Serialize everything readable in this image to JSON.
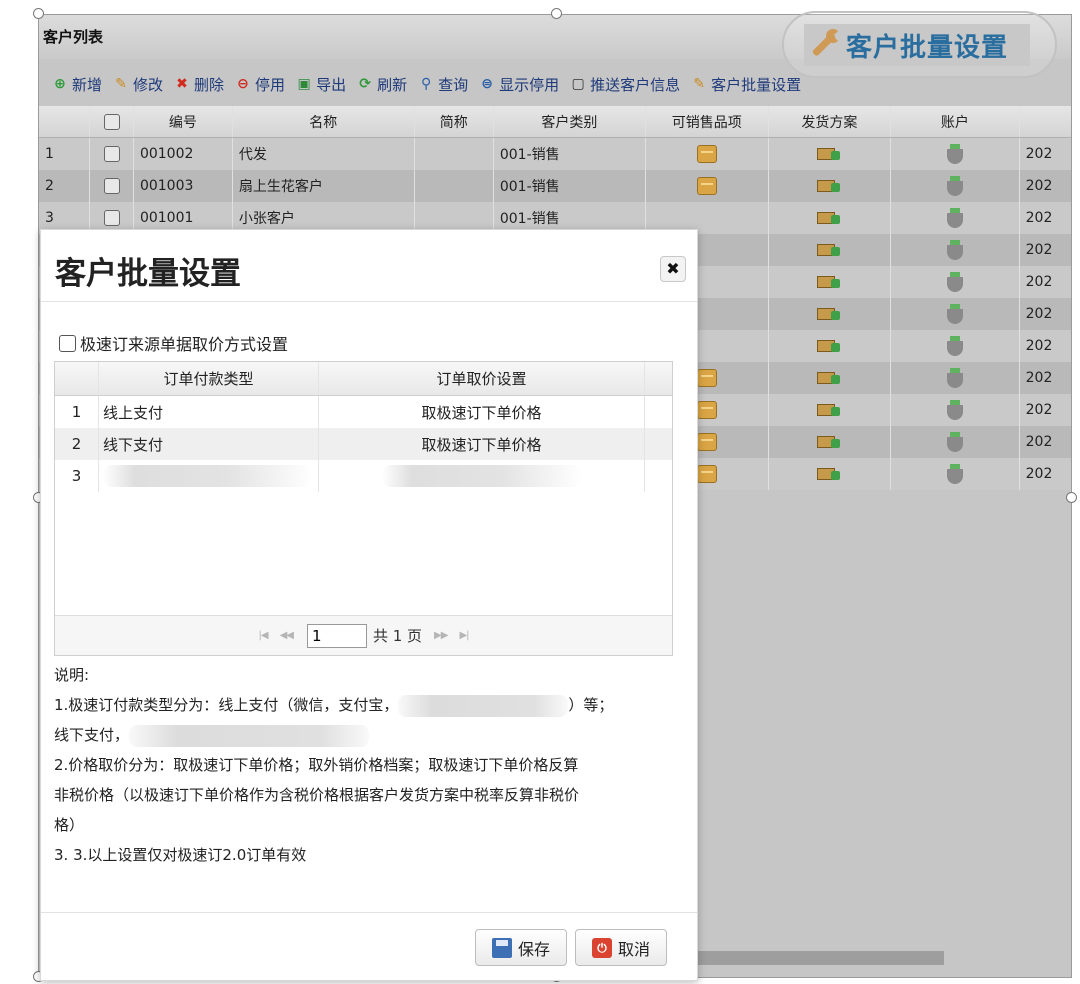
{
  "background": {
    "panel_title": "客户列表",
    "toolbar": [
      {
        "label": "新增",
        "icon": "add-icon",
        "glyph": "⊕",
        "color": "#2e9a3a"
      },
      {
        "label": "修改",
        "icon": "edit-icon",
        "glyph": "✎",
        "color": "#c98a1e"
      },
      {
        "label": "删除",
        "icon": "delete-icon",
        "glyph": "✖",
        "color": "#d22a1e"
      },
      {
        "label": "停用",
        "icon": "disable-icon",
        "glyph": "⊖",
        "color": "#d22a1e"
      },
      {
        "label": "导出",
        "icon": "excel-icon",
        "glyph": "▣",
        "color": "#2e8a3a"
      },
      {
        "label": "刷新",
        "icon": "refresh-icon",
        "glyph": "⟳",
        "color": "#2e9a3a"
      },
      {
        "label": "查询",
        "icon": "search-icon",
        "glyph": "⚲",
        "color": "#2a5fa8"
      },
      {
        "label": "显示停用",
        "icon": "show-disabled-icon",
        "glyph": "⊜",
        "color": "#2a5fa8"
      },
      {
        "label": "推送客户信息",
        "icon": "clipboard-icon",
        "glyph": "▢",
        "color": "#333333"
      },
      {
        "label": "客户批量设置",
        "icon": "wrench-icon",
        "glyph": "✎",
        "color": "#c98a1e"
      }
    ],
    "columns": [
      "编号",
      "名称",
      "简称",
      "客户类别",
      "可销售品项",
      "发货方案",
      "账户"
    ],
    "rows": [
      {
        "n": "1",
        "code": "001002",
        "name": "代发",
        "short": "",
        "category": "001-销售",
        "goods": true,
        "date": "202"
      },
      {
        "n": "2",
        "code": "001003",
        "name": "扇上生花客户",
        "short": "",
        "category": "001-销售",
        "goods": true,
        "date": "202"
      },
      {
        "n": "3",
        "code": "001001",
        "name": "小张客户",
        "short": "",
        "category": "001-销售",
        "goods": false,
        "date": "202"
      },
      {
        "n": "",
        "code": "",
        "name": "",
        "short": "",
        "category": "",
        "goods": false,
        "date": "202"
      },
      {
        "n": "",
        "code": "",
        "name": "",
        "short": "",
        "category": "",
        "goods": false,
        "date": "202"
      },
      {
        "n": "",
        "code": "",
        "name": "",
        "short": "",
        "category": "",
        "goods": false,
        "date": "202"
      },
      {
        "n": "",
        "code": "",
        "name": "",
        "short": "",
        "category": "",
        "goods": false,
        "date": "202"
      },
      {
        "n": "",
        "code": "",
        "name": "",
        "short": "",
        "category": "",
        "goods": true,
        "date": "202"
      },
      {
        "n": "",
        "code": "",
        "name": "",
        "short": "",
        "category": "",
        "goods": true,
        "date": "202"
      },
      {
        "n": "",
        "code": "",
        "name": "",
        "short": "",
        "category": "",
        "goods": true,
        "date": "202"
      },
      {
        "n": "",
        "code": "",
        "name": "",
        "short": "",
        "category": "",
        "goods": true,
        "date": "202"
      }
    ]
  },
  "callout": {
    "label": "客户批量设置"
  },
  "dialog": {
    "title": "客户批量设置",
    "close_glyph": "✖",
    "option_label": "极速订来源单据取价方式设置",
    "grid": {
      "col_type": "订单付款类型",
      "col_price": "订单取价设置",
      "rows": [
        {
          "n": "1",
          "type": "线上支付",
          "price": "取极速订下单价格"
        },
        {
          "n": "2",
          "type": "线下支付",
          "price": "取极速订下单价格"
        },
        {
          "n": "3",
          "type": "",
          "price": ""
        }
      ]
    },
    "pager": {
      "first": "|◀",
      "prev": "◀◀",
      "page": "1",
      "total": "共 1 页",
      "next": "▶▶",
      "last": "▶|"
    },
    "notes": {
      "heading": "说明:",
      "line1": "1.极速订付款类型分为：线上支付（微信，支付宝，",
      "line1_end": "）等；",
      "line2": "线下支付，",
      "line3": "2.价格取价分为：取极速订下单价格；取外销价格档案；取极速订下单价格反算",
      "line4": "非税价格（以极速订下单价格作为含税价格根据客户发货方案中税率反算非税价",
      "line5": "格）",
      "line6": "3. 3.以上设置仅对极速订2.0订单有效"
    },
    "save_label": "保存",
    "cancel_label": "取消"
  }
}
